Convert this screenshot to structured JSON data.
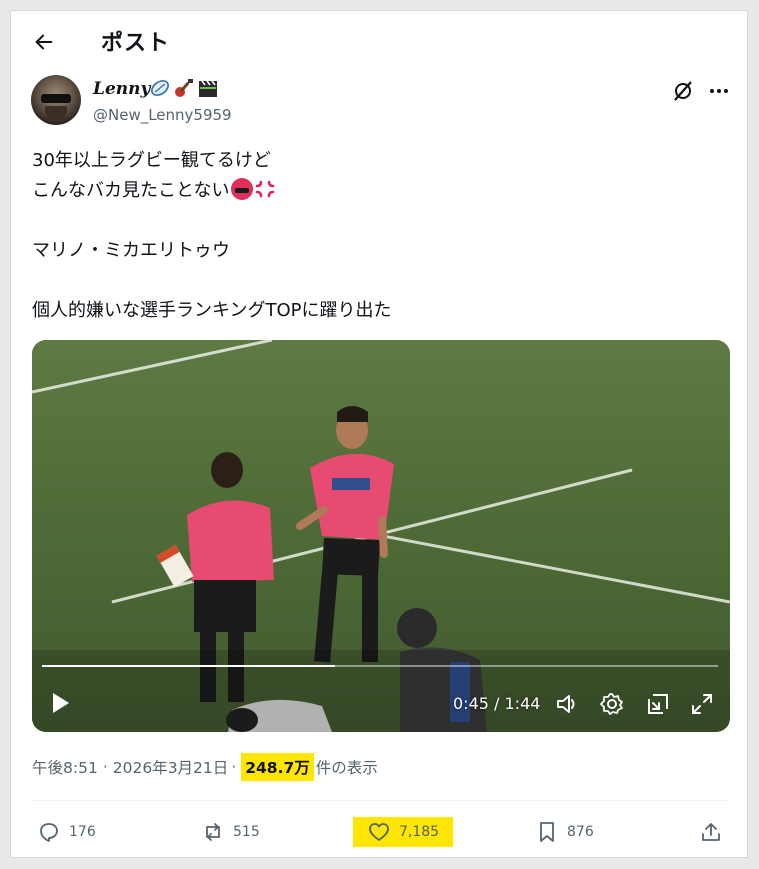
{
  "header": {
    "title": "ポスト"
  },
  "author": {
    "display_name": "Lenny",
    "handle": "@New_Lenny5959",
    "name_emojis": [
      "rugby-ball-emoji",
      "guitar-emoji",
      "clapper-board-emoji"
    ]
  },
  "post": {
    "lines": [
      "30年以上ラグビー観てるけど",
      "こんなバカ見たことない",
      "",
      "マリノ・ミカエリトゥウ",
      "",
      "個人的嫌いな選手ランキングTOPに躍り出た"
    ],
    "line2_emojis": [
      "angry-face-emoji",
      "anger-symbol-emoji"
    ]
  },
  "video": {
    "time_display": "0:45 / 1:44",
    "progress": 0.433
  },
  "meta": {
    "time": "午後8:51",
    "separator": "·",
    "date": "2026年3月21日",
    "views": "248.7万",
    "views_suffix": "件の表示"
  },
  "actions": {
    "replies": "176",
    "reposts": "515",
    "likes": "7,185",
    "bookmarks": "876"
  },
  "colors": {
    "highlight": "#ffe600",
    "secondary_text": "#536471",
    "pitch": "#4f6b3a"
  }
}
